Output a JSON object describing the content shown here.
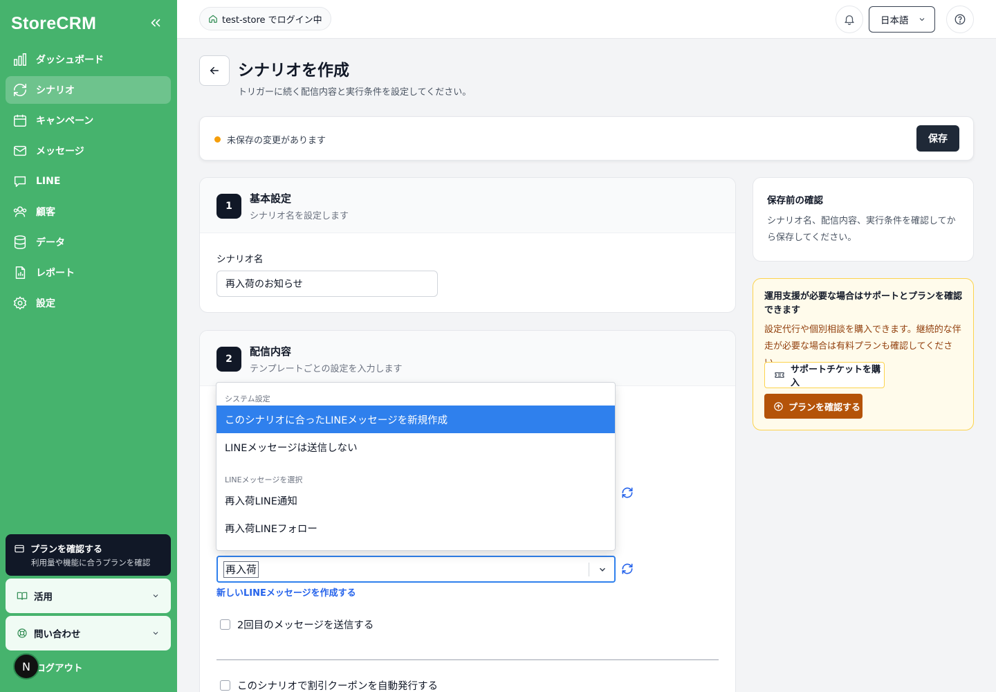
{
  "sidebar": {
    "brand": "StoreCRM",
    "items": [
      {
        "label": "ダッシュボード",
        "icon": "bar-chart-icon"
      },
      {
        "label": "シナリオ",
        "icon": "refresh-icon"
      },
      {
        "label": "キャンペーン",
        "icon": "calendar-icon"
      },
      {
        "label": "メッセージ",
        "icon": "mail-icon"
      },
      {
        "label": "LINE",
        "icon": "chat-icon"
      },
      {
        "label": "顧客",
        "icon": "users-icon"
      },
      {
        "label": "データ",
        "icon": "database-icon"
      },
      {
        "label": "レポート",
        "icon": "report-icon"
      },
      {
        "label": "設定",
        "icon": "gear-icon"
      }
    ],
    "active_item": "シナリオ",
    "plan_card": {
      "title": "プランを確認する",
      "subtitle": "利用量や機能に合うプランを確認"
    },
    "utilize_label": "活用",
    "contact_label": "問い合わせ",
    "logout_label": "ログアウト",
    "avatar_initial": "N"
  },
  "topbar": {
    "store_label": "test-store でログイン中",
    "language": "日本語"
  },
  "page": {
    "title": "シナリオを作成",
    "subtitle": "トリガーに続く配信内容と実行条件を設定してください。",
    "unsaved_text": "未保存の変更があります",
    "save_label": "保存"
  },
  "basic": {
    "step": "1",
    "title": "基本設定",
    "subtitle": "シナリオ名を設定します",
    "name_label": "シナリオ名",
    "name_value": "再入荷のお知らせ"
  },
  "delivery": {
    "step": "2",
    "title": "配信内容",
    "subtitle": "テンプレートごとの設定を入力します",
    "select_value": "再入荷",
    "new_line_link": "新しいLINEメッセージを作成する",
    "second_message_label": "2回目のメッセージを送信する",
    "coupon_label": "このシナリオで割引クーポンを自動発行する"
  },
  "dropdown": {
    "group_system": "システム設定",
    "opt_create": "このシナリオに合ったLINEメッセージを新規作成",
    "opt_none": "LINEメッセージは送信しない",
    "group_select": "LINEメッセージを選択",
    "opt_notice": "再入荷LINE通知",
    "opt_follow": "再入荷LINEフォロー"
  },
  "confirm": {
    "title": "保存前の確認",
    "desc": "シナリオ名、配信内容、実行条件を確認してから保存してください。"
  },
  "support": {
    "title": "運用支援が必要な場合はサポートとプランを確認できます",
    "desc": "設定代行や個別相談を購入できます。継続的な伴走が必要な場合は有料プランも確認してください。",
    "ticket_label": "サポートチケットを購入",
    "plan_label": "プランを確認する"
  },
  "colors": {
    "sidebar": "#46b36d",
    "accent_blue": "#2f80ed",
    "warning": "#f59e0b",
    "dark": "#111827"
  }
}
